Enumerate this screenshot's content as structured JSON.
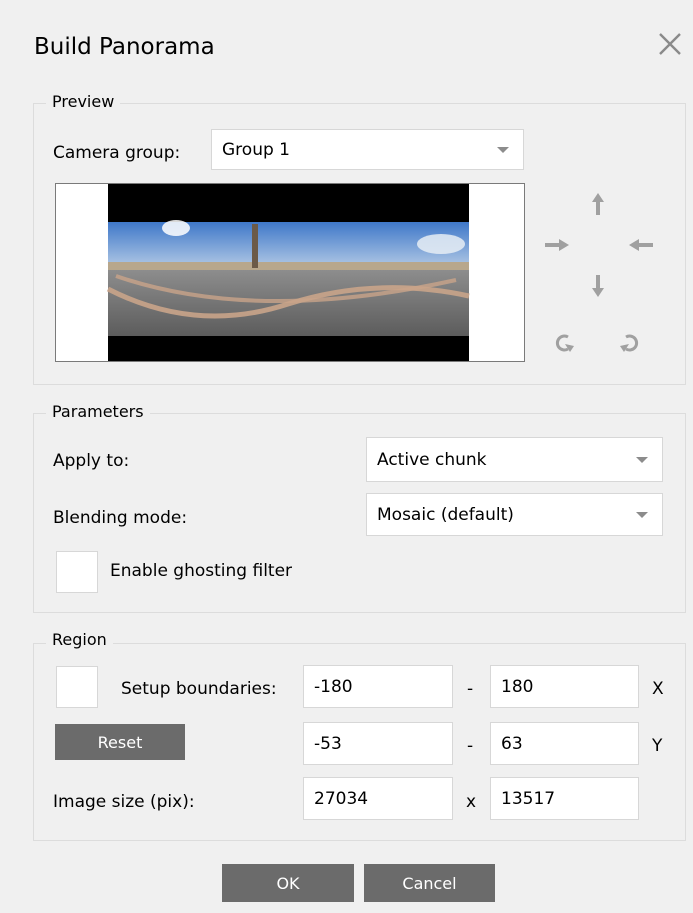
{
  "dialog": {
    "title": "Build Panorama"
  },
  "preview": {
    "legend": "Preview",
    "camera_group_label": "Camera group:",
    "camera_group_value": "Group 1"
  },
  "parameters": {
    "legend": "Parameters",
    "apply_to_label": "Apply to:",
    "apply_to_value": "Active chunk",
    "blending_label": "Blending mode:",
    "blending_value": "Mosaic (default)",
    "ghosting_label": "Enable ghosting filter"
  },
  "region": {
    "legend": "Region",
    "setup_label": "Setup boundaries:",
    "x_min": "-180",
    "x_dash": "-",
    "x_max": "180",
    "x_axis": "X",
    "reset_label": "Reset",
    "y_min": "-53",
    "y_dash": "-",
    "y_max": "63",
    "y_axis": "Y",
    "image_size_label": "Image size (pix):",
    "width": "27034",
    "size_sep": "x",
    "height": "13517"
  },
  "footer": {
    "ok_label": "OK",
    "cancel_label": "Cancel"
  },
  "icons": [
    "close-icon",
    "arrow-up-icon",
    "arrow-right-icon",
    "arrow-left-icon",
    "arrow-down-icon",
    "rotate-left-icon",
    "rotate-right-icon"
  ],
  "colors": {
    "button": "#6b6b6b",
    "background": "#f0f0f0",
    "icon": "#a0a0a0"
  }
}
